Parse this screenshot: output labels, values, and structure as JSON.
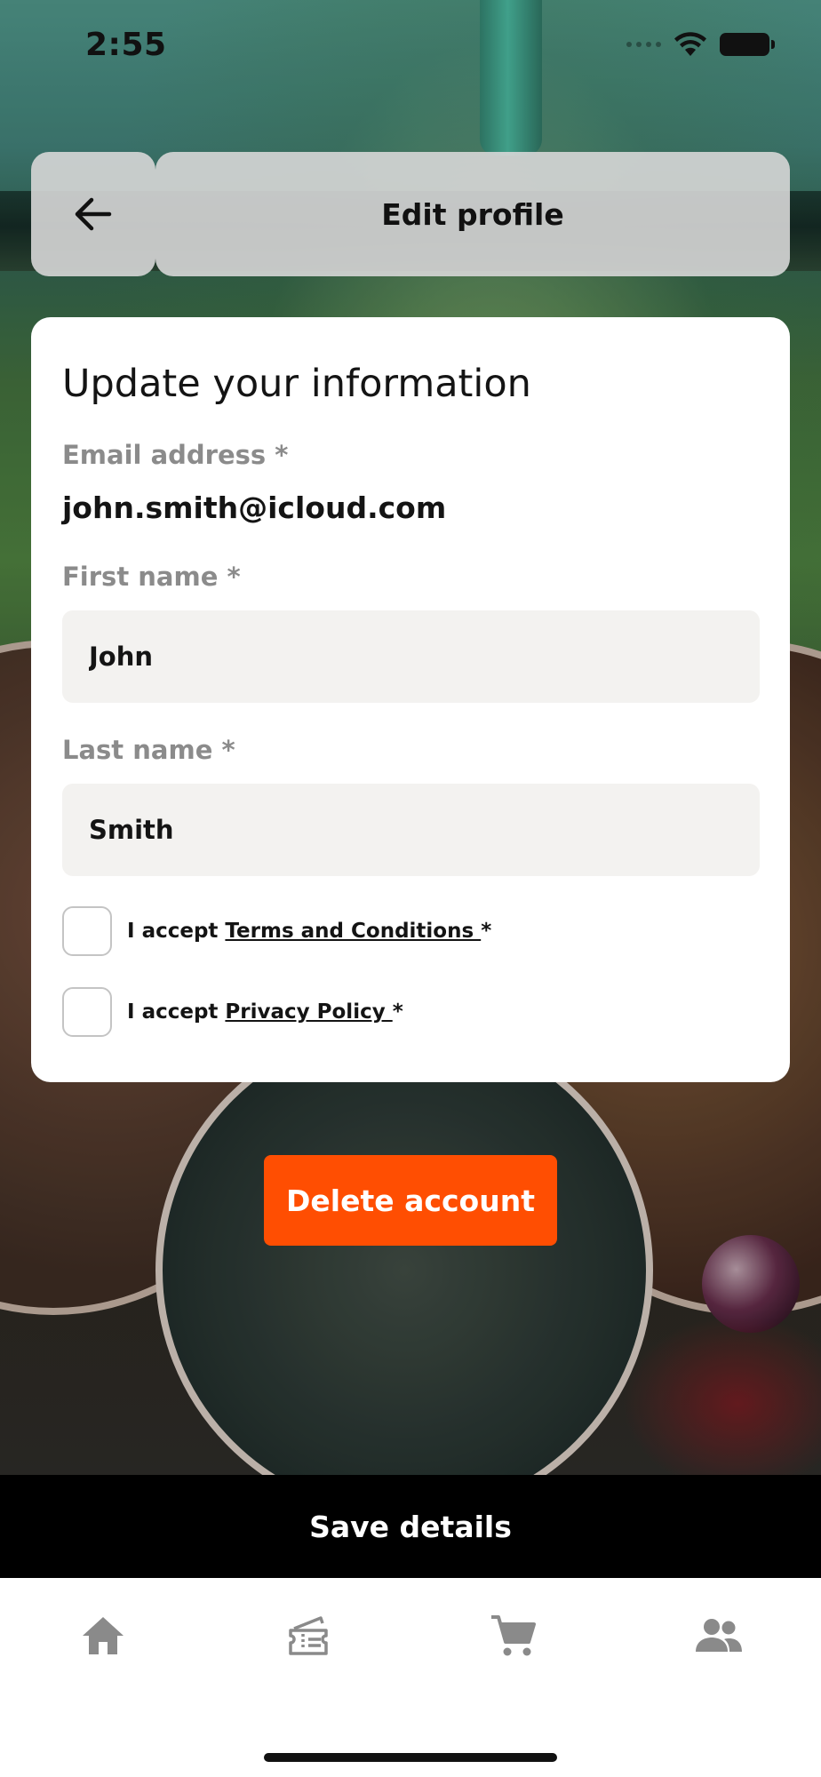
{
  "status_bar": {
    "time": "2:55"
  },
  "header": {
    "title": "Edit profile"
  },
  "form": {
    "heading": "Update your information",
    "email": {
      "label": "Email address *",
      "value": "john.smith@icloud.com"
    },
    "first_name": {
      "label": "First name *",
      "value": "John"
    },
    "last_name": {
      "label": "Last name *",
      "value": "Smith"
    },
    "terms": {
      "prefix": "I accept ",
      "link": "Terms and Conditions ",
      "suffix": "*",
      "checked": false
    },
    "privacy": {
      "prefix": "I accept ",
      "link": "Privacy Policy ",
      "suffix": "*",
      "checked": false
    }
  },
  "actions": {
    "delete_label": "Delete account",
    "save_label": "Save details"
  },
  "tab_bar": {
    "items": [
      {
        "icon": "home-icon"
      },
      {
        "icon": "ticket-icon"
      },
      {
        "icon": "cart-icon"
      },
      {
        "icon": "people-icon"
      }
    ]
  },
  "colors": {
    "accent": "#ff4e02",
    "save_bar": "#000000",
    "input_bg": "#f3f2f0",
    "tab_icon": "#8a8a8a"
  }
}
